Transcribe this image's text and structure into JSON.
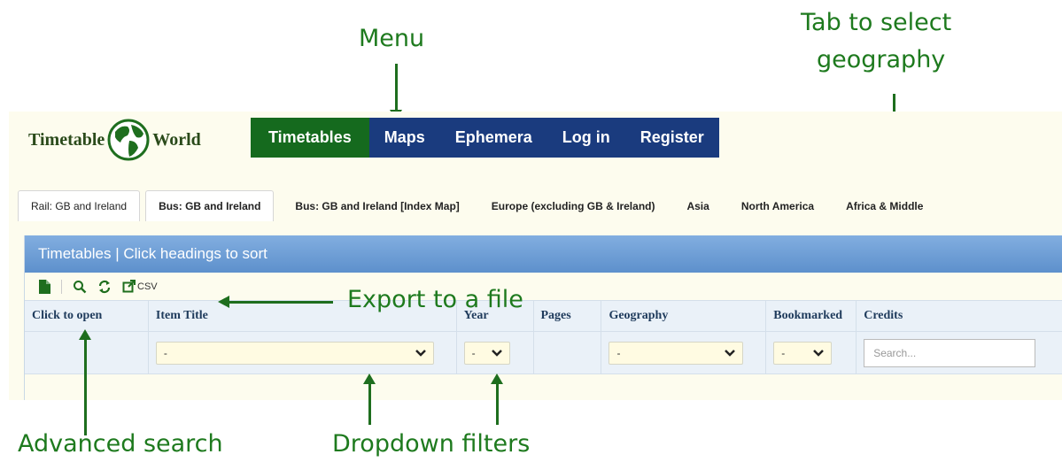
{
  "annotations": {
    "menu": "Menu",
    "tab_line1": "Tab to select",
    "tab_line2": "geography",
    "export": "Export to a file",
    "advanced_search": "Advanced search",
    "dropdown_filters": "Dropdown filters"
  },
  "logo": {
    "left": "Timetable",
    "right": "World"
  },
  "menu": [
    "Timetables",
    "Maps",
    "Ephemera",
    "Log in",
    "Register"
  ],
  "tabs": [
    "Rail: GB and Ireland",
    "Bus: GB and Ireland",
    "Bus: GB and Ireland [Index Map]",
    "Europe (excluding GB & Ireland)",
    "Asia",
    "North America",
    "Africa & Middle"
  ],
  "panel": {
    "title": "Timetables | Click headings to sort"
  },
  "toolbar": {
    "export_label": "CSV"
  },
  "columns": [
    "Click to open",
    "Item Title",
    "Year",
    "Pages",
    "Geography",
    "Bookmarked",
    "Credits"
  ],
  "filters": {
    "item_title": "-",
    "year": "-",
    "geography": "-",
    "bookmarked": "-",
    "credits_placeholder": "Search..."
  },
  "colors": {
    "annotation": "#1e7a1e",
    "menu_active": "#156a1e",
    "menu": "#1a3b7e",
    "panel_header": "#6a9ad4"
  }
}
